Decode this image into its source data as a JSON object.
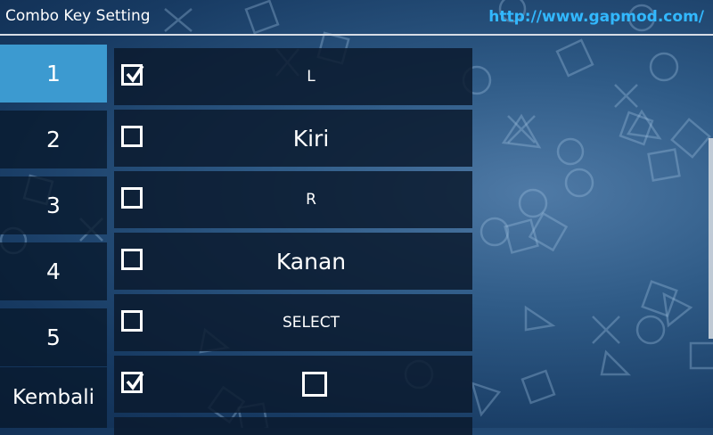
{
  "header": {
    "title": "Combo Key Setting",
    "url": "http://www.gapmod.com/"
  },
  "sidebar": {
    "items": [
      {
        "label": "1",
        "active": true
      },
      {
        "label": "2",
        "active": false
      },
      {
        "label": "3",
        "active": false
      },
      {
        "label": "4",
        "active": false
      },
      {
        "label": "5",
        "active": false
      },
      {
        "label": "Kembali",
        "active": false
      }
    ]
  },
  "keys": [
    {
      "label": "L",
      "checked": true
    },
    {
      "label": "Kiri",
      "checked": false
    },
    {
      "label": "R",
      "checked": false
    },
    {
      "label": "Kanan",
      "checked": false
    },
    {
      "label": "SELECT",
      "checked": false
    },
    {
      "label": "",
      "checked": true,
      "icon": "square-button-icon"
    }
  ],
  "colors": {
    "active_tab": "#3c9ad0",
    "url": "#32b8ff"
  }
}
